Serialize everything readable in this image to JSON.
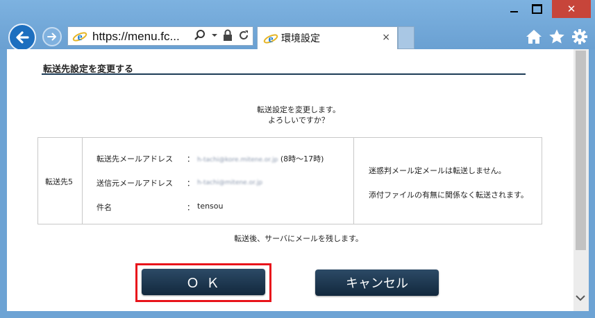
{
  "browser": {
    "address_url": "https://menu.fc...",
    "tab_title": "環境設定",
    "tab_close": "×",
    "window_close": "✕"
  },
  "page": {
    "section_title": "転送先設定を変更する",
    "confirm_line1": "転送設定を変更します。",
    "confirm_line2": "よろしいですか？",
    "destination_label": "転送先5",
    "rows": [
      {
        "label": "転送先メールアドレス",
        "colon": "：",
        "value": "h-tachi@kore.mitene.or.jp",
        "suffix": "(8時～17時)"
      },
      {
        "label": "送信元メールアドレス",
        "colon": "：",
        "value": "h-tachi@mitene.or.jp",
        "suffix": ""
      },
      {
        "label": "件名",
        "colon": "：",
        "value": "tensou",
        "suffix": ""
      }
    ],
    "note1": "迷惑判メール定メールは転送しません。",
    "note2": "添付ファイルの有無に関係なく転送されます。",
    "after_note": "転送後、サーバにメールを残します。",
    "ok_label": "Ｏ Ｋ",
    "cancel_label": "キャンセル"
  },
  "colors": {
    "button_dark": "#1b3550",
    "highlight_red": "#e8141b",
    "chrome_blue": "#6da3d4"
  }
}
